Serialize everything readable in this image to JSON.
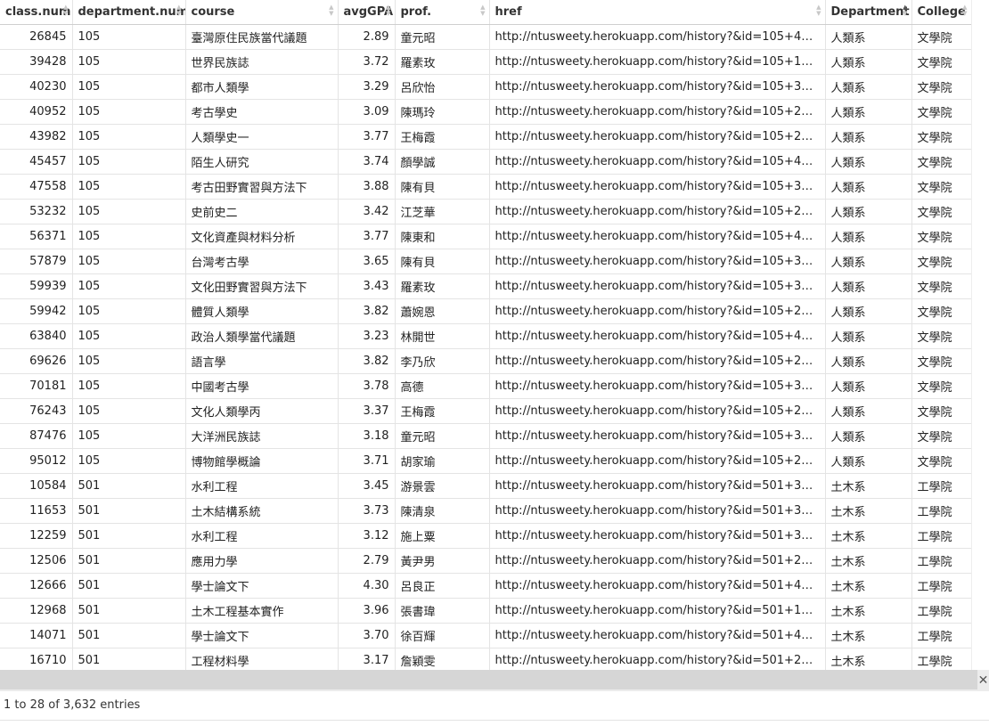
{
  "columns": [
    "class.num",
    "department.num",
    "course",
    "avgGPA",
    "prof.",
    "href",
    "Department",
    "College"
  ],
  "rows": [
    [
      "26845",
      "105",
      "臺灣原住民族當代議題",
      "2.89",
      "童元昭",
      "http://ntusweety.herokuapp.com/history?&id=105+42...",
      "人類系",
      "文學院"
    ],
    [
      "39428",
      "105",
      "世界民族誌",
      "3.72",
      "羅素玫",
      "http://ntusweety.herokuapp.com/history?&id=105+12...",
      "人類系",
      "文學院"
    ],
    [
      "40230",
      "105",
      "都市人類學",
      "3.29",
      "呂欣怡",
      "http://ntusweety.herokuapp.com/history?&id=105+36...",
      "人類系",
      "文學院"
    ],
    [
      "40952",
      "105",
      "考古學史",
      "3.09",
      "陳瑪玲",
      "http://ntusweety.herokuapp.com/history?&id=105+22...",
      "人類系",
      "文學院"
    ],
    [
      "43982",
      "105",
      "人類學史一",
      "3.77",
      "王梅霞",
      "http://ntusweety.herokuapp.com/history?&id=105+24...",
      "人類系",
      "文學院"
    ],
    [
      "45457",
      "105",
      "陌生人研究",
      "3.74",
      "顏學誠",
      "http://ntusweety.herokuapp.com/history?&id=105+41...",
      "人類系",
      "文學院"
    ],
    [
      "47558",
      "105",
      "考古田野實習與方法下",
      "3.88",
      "陳有貝",
      "http://ntusweety.herokuapp.com/history?&id=105+30...",
      "人類系",
      "文學院"
    ],
    [
      "53232",
      "105",
      "史前史二",
      "3.42",
      "江芝華",
      "http://ntusweety.herokuapp.com/history?&id=105+20...",
      "人類系",
      "文學院"
    ],
    [
      "56371",
      "105",
      "文化資產與材料分析",
      "3.77",
      "陳東和",
      "http://ntusweety.herokuapp.com/history?&id=105+41...",
      "人類系",
      "文學院"
    ],
    [
      "57879",
      "105",
      "台灣考古學",
      "3.65",
      "陳有貝",
      "http://ntusweety.herokuapp.com/history?&id=105+32...",
      "人類系",
      "文學院"
    ],
    [
      "59939",
      "105",
      "文化田野實習與方法下",
      "3.43",
      "羅素玫",
      "http://ntusweety.herokuapp.com/history?&id=105+30...",
      "人類系",
      "文學院"
    ],
    [
      "59942",
      "105",
      "體質人類學",
      "3.82",
      "蕭婉恩",
      "http://ntusweety.herokuapp.com/history?&id=105+20...",
      "人類系",
      "文學院"
    ],
    [
      "63840",
      "105",
      "政治人類學當代議題",
      "3.23",
      "林開世",
      "http://ntusweety.herokuapp.com/history?&id=105+41...",
      "人類系",
      "文學院"
    ],
    [
      "69626",
      "105",
      "語言學",
      "3.82",
      "李乃欣",
      "http://ntusweety.herokuapp.com/history?&id=105+21...",
      "人類系",
      "文學院"
    ],
    [
      "70181",
      "105",
      "中國考古學",
      "3.78",
      "高德",
      "http://ntusweety.herokuapp.com/history?&id=105+33...",
      "人類系",
      "文學院"
    ],
    [
      "76243",
      "105",
      "文化人類學丙",
      "3.37",
      "王梅霞",
      "http://ntusweety.herokuapp.com/history?&id=105+20...",
      "人類系",
      "文學院"
    ],
    [
      "87476",
      "105",
      "大洋洲民族誌",
      "3.18",
      "童元昭",
      "http://ntusweety.herokuapp.com/history?&id=105+33...",
      "人類系",
      "文學院"
    ],
    [
      "95012",
      "105",
      "博物館學概論",
      "3.71",
      "胡家瑜",
      "http://ntusweety.herokuapp.com/history?&id=105+29...",
      "人類系",
      "文學院"
    ],
    [
      "10584",
      "501",
      "水利工程",
      "3.45",
      "游景雲",
      "http://ntusweety.herokuapp.com/history?&id=501+33...",
      "土木系",
      "工學院"
    ],
    [
      "11653",
      "501",
      "土木結構系統",
      "3.73",
      "陳清泉",
      "http://ntusweety.herokuapp.com/history?&id=501+32...",
      "土木系",
      "工學院"
    ],
    [
      "12259",
      "501",
      "水利工程",
      "3.12",
      "施上粟",
      "http://ntusweety.herokuapp.com/history?&id=501+33...",
      "土木系",
      "工學院"
    ],
    [
      "12506",
      "501",
      "應用力學",
      "2.79",
      "黃尹男",
      "http://ntusweety.herokuapp.com/history?&id=501+21...",
      "土木系",
      "工學院"
    ],
    [
      "12666",
      "501",
      "學士論文下",
      "4.30",
      "呂良正",
      "http://ntusweety.herokuapp.com/history?&id=501+49...",
      "土木系",
      "工學院"
    ],
    [
      "12968",
      "501",
      "土木工程基本實作",
      "3.96",
      "張書瑋",
      "http://ntusweety.herokuapp.com/history?&id=501+10...",
      "土木系",
      "工學院"
    ],
    [
      "14071",
      "501",
      "學士論文下",
      "3.70",
      "徐百輝",
      "http://ntusweety.herokuapp.com/history?&id=501+49...",
      "土木系",
      "工學院"
    ],
    [
      "16710",
      "501",
      "工程材料學",
      "3.17",
      "詹穎雯",
      "http://ntusweety.herokuapp.com/history?&id=501+27...",
      "土木系",
      "工學院"
    ]
  ],
  "numeric_columns": [
    0,
    3
  ],
  "sorted_column": 6,
  "info": "1 to 28 of 3,632 entries",
  "scroll_right_icon": "close-icon"
}
